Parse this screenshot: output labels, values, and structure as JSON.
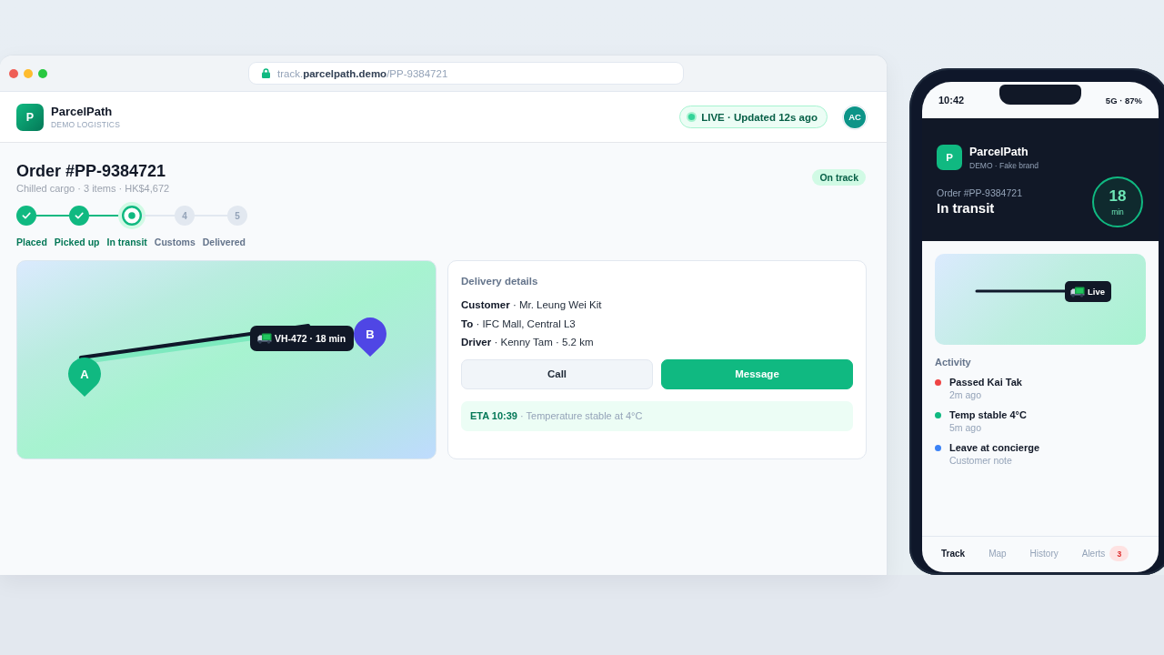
{
  "browser": {
    "url": "track.**parcelpath.demo**/PP-9384721"
  },
  "header": {
    "brand": {
      "logo_letter": "P",
      "name": "ParcelPath",
      "tagline": "DEMO LOGISTICS"
    },
    "live_status": "LIVE · Updated 12s ago",
    "avatar_initials": "AC"
  },
  "order": {
    "title": "Order #PP-9384721",
    "subtitle": "Chilled cargo · 3 items · HK$4,672",
    "status_tag": "On track",
    "steps": [
      {
        "label": "Placed",
        "done": true,
        "active": false
      },
      {
        "label": "Picked up",
        "done": true,
        "active": false
      },
      {
        "label": "In transit",
        "done": false,
        "active": true
      },
      {
        "label": "Customs",
        "done": false,
        "active": false,
        "number": "4"
      },
      {
        "label": "Delivered",
        "done": false,
        "active": false,
        "number": "5"
      }
    ]
  },
  "map": {
    "origin_pin": "A",
    "destination_pin": "B",
    "vehicle_label": "VH-472 · 18 min"
  },
  "delivery_details": {
    "title": "Delivery details",
    "lines": [
      "**Customer** · Mr. Leung Wei Kit",
      "**To** · IFC Mall, Central L3",
      "**Driver** · Kenny Tam · 5.2 km"
    ],
    "buttons": [
      {
        "label": "Call",
        "kind": "secondary"
      },
      {
        "label": "Message",
        "kind": "primary"
      }
    ],
    "eta_note": "**ETA 10:39** · Temperature stable at 4°C"
  },
  "phone": {
    "status_bar": {
      "time": "10:42",
      "network": "5G · 87%"
    },
    "brand": {
      "logo_letter": "P",
      "name": "ParcelPath",
      "tagline": "DEMO · Fake brand"
    },
    "order_number": "Order #PP-9384721",
    "status": "In transit",
    "eta": {
      "value": "18",
      "unit": "min"
    },
    "map": {
      "label": "Live"
    },
    "activity": {
      "title": "Activity",
      "items": [
        {
          "title": "Passed Kai Tak",
          "subtitle": "2m ago",
          "color": "#ef4444"
        },
        {
          "title": "Temp stable 4°C",
          "subtitle": "5m ago",
          "color": "#10b981"
        },
        {
          "title": "Leave at concierge",
          "subtitle": "Customer note",
          "color": "#3b82f6"
        }
      ]
    },
    "tabs": [
      {
        "label": "Track",
        "selected": true
      },
      {
        "label": "Map",
        "selected": false
      },
      {
        "label": "History",
        "selected": false
      },
      {
        "label": "Alerts",
        "selected": false,
        "badge": "3"
      }
    ]
  }
}
